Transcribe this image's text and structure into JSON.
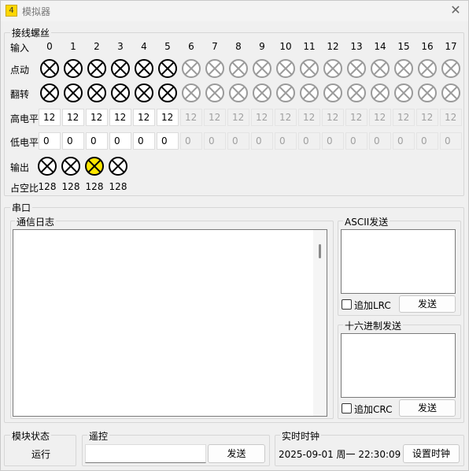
{
  "window": {
    "icon_text": "4",
    "title": "模拟器"
  },
  "terminals": {
    "legend": "接线螺丝",
    "indices": [
      "0",
      "1",
      "2",
      "3",
      "4",
      "5",
      "6",
      "7",
      "8",
      "9",
      "10",
      "11",
      "12",
      "13",
      "14",
      "15",
      "16",
      "17"
    ],
    "row_labels": {
      "input": "输入",
      "jog": "点动",
      "toggle": "翻转",
      "high_level": "高电平",
      "low_level": "低电平"
    },
    "active_count": 6,
    "high_values": [
      "12",
      "12",
      "12",
      "12",
      "12",
      "12",
      "12",
      "12",
      "12",
      "12",
      "12",
      "12",
      "12",
      "12",
      "12",
      "12",
      "12",
      "12"
    ],
    "low_values": [
      "0",
      "0",
      "0",
      "0",
      "0",
      "0",
      "0",
      "0",
      "0",
      "0",
      "0",
      "0",
      "0",
      "0",
      "0",
      "0",
      "0",
      "0"
    ],
    "output_label": "输出",
    "outputs": [
      {
        "on": false
      },
      {
        "on": false
      },
      {
        "on": true
      },
      {
        "on": false
      }
    ],
    "duty_label": "占空比",
    "duty_values": [
      "128",
      "128",
      "128",
      "128"
    ],
    "colors": {
      "lamp_on": "#ffe600",
      "lamp_active": "#000000",
      "lamp_inactive": "#9a9a9a"
    }
  },
  "serial": {
    "legend": "串口",
    "log_legend": "通信日志",
    "ascii_legend": "ASCII发送",
    "ascii_checkbox": "追加LRC",
    "ascii_send": "发送",
    "hex_legend": "十六进制发送",
    "hex_checkbox": "追加CRC",
    "hex_send": "发送"
  },
  "module_status": {
    "legend": "模块状态",
    "value": "运行"
  },
  "remote": {
    "legend": "遥控",
    "input_value": "",
    "send": "发送"
  },
  "clock": {
    "legend": "实时时钟",
    "value": "2025-09-01 周一 22:30:09",
    "set_button": "设置时钟"
  }
}
